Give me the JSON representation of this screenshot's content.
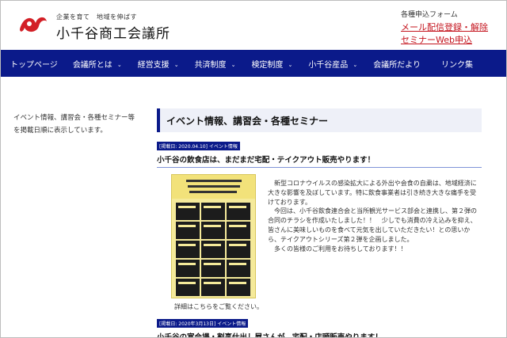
{
  "header": {
    "tagline": "企業を育て　地域を伸ばす",
    "site_name": "小千谷商工会議所",
    "apply_label": "各種申込フォーム",
    "links": [
      "メール配信登録・解除",
      "セミナーWeb申込"
    ]
  },
  "nav": {
    "items": [
      {
        "label": "トップページ",
        "has_dropdown": false
      },
      {
        "label": "会議所とは",
        "has_dropdown": true
      },
      {
        "label": "経営支援",
        "has_dropdown": true
      },
      {
        "label": "共済制度",
        "has_dropdown": true
      },
      {
        "label": "検定制度",
        "has_dropdown": true
      },
      {
        "label": "小千谷産品",
        "has_dropdown": true
      },
      {
        "label": "会議所だより",
        "has_dropdown": false
      },
      {
        "label": "リンク集",
        "has_dropdown": false
      }
    ]
  },
  "sidebar": {
    "description": "イベント情報、講習会・各種セミナー等を掲載日順に表示しています。"
  },
  "main": {
    "page_title": "イベント情報、講習会・各種セミナー",
    "posts": [
      {
        "meta": "[掲載日: 2020.04.10]  イベント情報",
        "title": "小千谷の飲食店は、まだまだ宅配・テイクアウト販売やります！",
        "paragraphs": [
          "新型コロナウイルスの感染拡大による外出や会食の自粛は、地域経済に大きな影響を及ぼしています。特に飲食事業者は引き続き大きな痛手を受けております。",
          "今回は、小千谷飲食連合会と当所観光サービス部会と連携し、第２弾の合同のチラシを作成いたしました！！　少しでも消費の冷え込みを抑え、皆さんに美味しいものを食べて元気を出していただきたい！との思いから、テイクアウトシリーズ第２弾を企画しました。",
          "多くの皆様のご利用をお待ちしております！！"
        ],
        "detail_link": "詳細はこちらをご覧ください。"
      },
      {
        "meta": "[掲載日: 2020年3月13日]  イベント情報",
        "title": "小千谷の宴会場・割烹仕出し屋さんが、宅配・店頭販売やります！"
      }
    ]
  },
  "colors": {
    "nav_bg": "#0b1a8a",
    "link_red": "#c4141e",
    "logo_red": "#d31f26",
    "flyer_yellow": "#f5ea9a"
  }
}
